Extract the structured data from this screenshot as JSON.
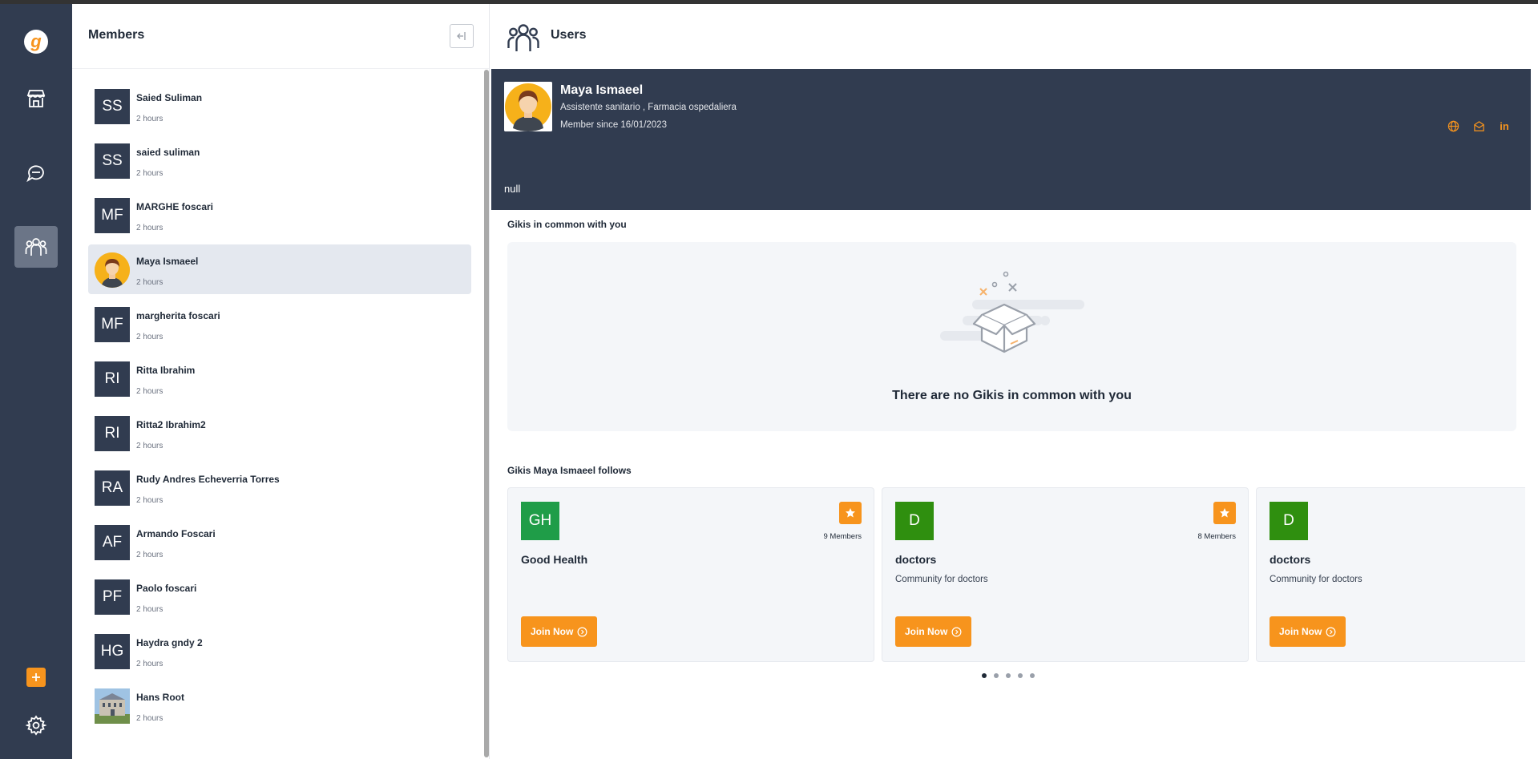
{
  "members_panel": {
    "title": "Members",
    "items": [
      {
        "initials": "SS",
        "name": "Saied Suliman",
        "time": "2 hours"
      },
      {
        "initials": "SS",
        "name": "saied suliman",
        "time": "2 hours"
      },
      {
        "initials": "MF",
        "name": "MARGHE foscari",
        "time": "2 hours"
      },
      {
        "initials": "",
        "name": "Maya Ismaeel",
        "time": "2 hours",
        "selected": true
      },
      {
        "initials": "MF",
        "name": "margherita foscari",
        "time": "2 hours"
      },
      {
        "initials": "RI",
        "name": "Ritta Ibrahim",
        "time": "2 hours"
      },
      {
        "initials": "RI",
        "name": "Ritta2 Ibrahim2",
        "time": "2 hours"
      },
      {
        "initials": "RA",
        "name": "Rudy Andres Echeverria Torres",
        "time": "2 hours"
      },
      {
        "initials": "AF",
        "name": "Armando Foscari",
        "time": "2 hours"
      },
      {
        "initials": "PF",
        "name": "Paolo foscari",
        "time": "2 hours"
      },
      {
        "initials": "HG",
        "name": "Haydra gndy 2",
        "time": "2 hours"
      },
      {
        "initials": "",
        "name": "Hans Root",
        "time": "2 hours"
      }
    ]
  },
  "main": {
    "title": "Users",
    "profile": {
      "name": "Maya Ismaeel",
      "role": "Assistente sanitario , Farmacia ospedaliera",
      "member_since": "Member since 16/01/2023",
      "bio": "null",
      "social_icons": [
        "globe-icon",
        "mail-icon",
        "linkedin-icon"
      ],
      "linkedin_label": "in"
    },
    "common_section": {
      "title": "Gikis in common with you",
      "empty_text": "There are no Gikis in common with you"
    },
    "follows_section": {
      "title": "Gikis Maya Ismaeel follows",
      "cards": [
        {
          "logo": "GH",
          "logo_color": "#1f9d48",
          "name": "Good Health",
          "description": "",
          "members": "9 Members",
          "join_label": "Join Now"
        },
        {
          "logo": "D",
          "logo_color": "#2f8f0f",
          "name": "doctors",
          "description": "Community for doctors",
          "members": "8 Members",
          "join_label": "Join Now"
        },
        {
          "logo": "D",
          "logo_color": "#2f8f0f",
          "name": "doctors",
          "description": "Community for doctors",
          "members": "",
          "join_label": "Join Now"
        }
      ],
      "page_count": 5,
      "current_page": 1
    }
  },
  "colors": {
    "sidebar": "#313c50",
    "accent": "#f7941d",
    "selected_row": "#e4e8ef"
  }
}
